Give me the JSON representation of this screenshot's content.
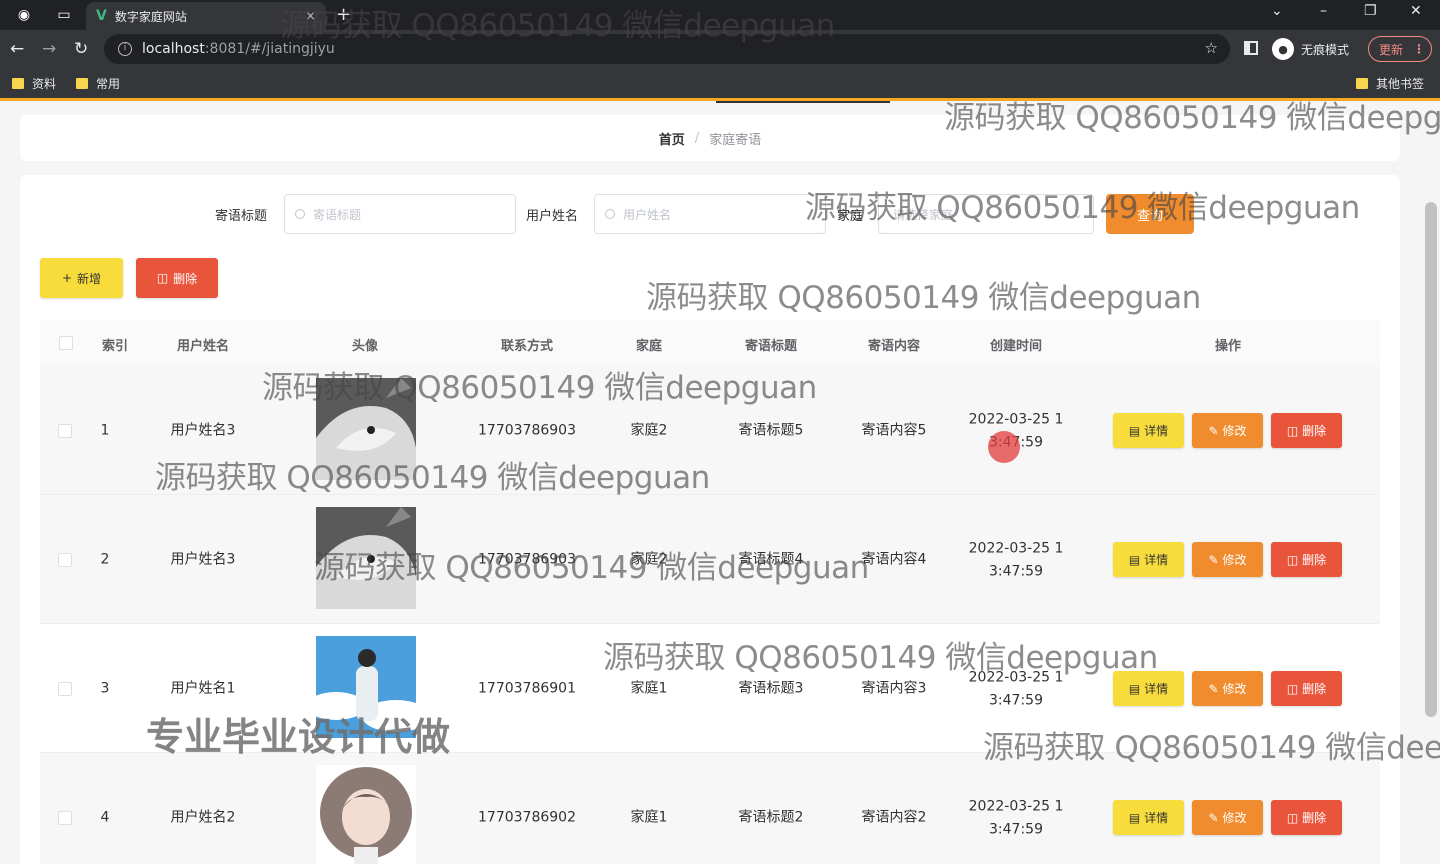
{
  "browser": {
    "tab_title": "数字家庭网站",
    "tab_close": "×",
    "new_tab": "+",
    "url_host": "localhost",
    "url_path": ":8081/#/jiatingjiyu",
    "incognito_label": "无痕模式",
    "update_label": "更新",
    "bookmarks": [
      "资料",
      "常用"
    ],
    "other_bookmarks": "其他书签"
  },
  "breadcrumb": {
    "home": "首页",
    "separator": "/",
    "current": "家庭寄语"
  },
  "search": {
    "title_label": "寄语标题",
    "title_placeholder": "寄语标题",
    "user_label": "用户姓名",
    "user_placeholder": "用户姓名",
    "family_label": "家庭",
    "family_placeholder": "请选择家庭",
    "query_button": "查询"
  },
  "toolbar": {
    "add_label": "新增",
    "delete_label": "删除"
  },
  "table": {
    "headers": [
      "索引",
      "用户姓名",
      "头像",
      "联系方式",
      "家庭",
      "寄语标题",
      "寄语内容",
      "创建时间",
      "操作"
    ],
    "rows": [
      {
        "index": "1",
        "user": "用户姓名3",
        "avatar": "wolf",
        "phone": "17703786903",
        "family": "家庭2",
        "title": "寄语标题5",
        "content": "寄语内容5",
        "time_line1": "2022-03-25 1",
        "time_line2": "3:47:59"
      },
      {
        "index": "2",
        "user": "用户姓名3",
        "avatar": "wolf",
        "phone": "17703786903",
        "family": "家庭2",
        "title": "寄语标题4",
        "content": "寄语内容4",
        "time_line1": "2022-03-25 1",
        "time_line2": "3:47:59"
      },
      {
        "index": "3",
        "user": "用户姓名1",
        "avatar": "sky",
        "phone": "17703786901",
        "family": "家庭1",
        "title": "寄语标题3",
        "content": "寄语内容3",
        "time_line1": "2022-03-25 1",
        "time_line2": "3:47:59"
      },
      {
        "index": "4",
        "user": "用户姓名2",
        "avatar": "girl",
        "phone": "17703786902",
        "family": "家庭1",
        "title": "寄语标题2",
        "content": "寄语内容2",
        "time_line1": "2022-03-25 1",
        "time_line2": "3:47:59"
      }
    ],
    "action_detail": "详情",
    "action_edit": "修改",
    "action_delete": "删除"
  },
  "watermarks": [
    "源码获取 QQ86050149 微信deepguan",
    "源码获取 QQ86050149 微信deepgu",
    "源码获取 QQ86050149 微信deepguan",
    "源码获取 QQ86050149 微信deepguan",
    "源码获取 QQ86050149 微信deepguan",
    "源码获取 QQ86050149 微信deepguan",
    "源码获取 QQ86050149 微信deepguan",
    "源码获取 QQ86050149 微信deepguan",
    "源码获取 QQ86050149 微信deep"
  ],
  "banner": "专业毕业设计代做",
  "colors": {
    "yellow": "#f7dc3b",
    "orange": "#f08c2e",
    "red": "#e8553b",
    "accent": "#f5a623"
  }
}
